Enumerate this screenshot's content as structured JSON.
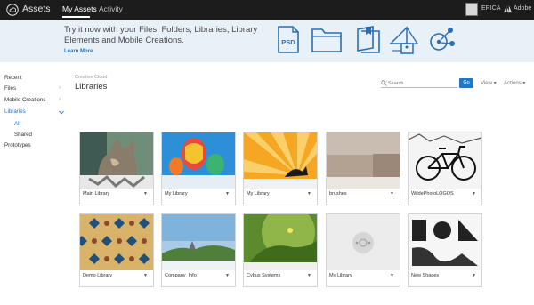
{
  "topbar": {
    "app_name": "Assets",
    "nav": [
      {
        "label": "My Assets"
      },
      {
        "label": "Activity"
      }
    ],
    "user_name": "ERICA",
    "company": "Adobe"
  },
  "banner": {
    "line1": "Try it now with your Files, Folders, Libraries, Library",
    "line2": "Elements and Mobile Creations.",
    "learn_more": "Learn More",
    "psd_label": "PSD",
    "icons": [
      "psd-file-icon",
      "folder-icon",
      "library-book-icon",
      "photoshop-icon",
      "share-network-icon"
    ]
  },
  "sidebar": {
    "items": [
      {
        "label": "Recent"
      },
      {
        "label": "Files"
      },
      {
        "label": "Mobile Creations"
      },
      {
        "label": "Libraries"
      },
      {
        "label": "All"
      },
      {
        "label": "Shared"
      },
      {
        "label": "Prototypes"
      }
    ]
  },
  "header": {
    "breadcrumb": "Creative Cloud",
    "title": "Libraries"
  },
  "toolbar": {
    "search_placeholder": "Search",
    "go_label": "Go",
    "view_label": "View",
    "actions_label": "Actions"
  },
  "libraries": [
    {
      "name": "Main Library"
    },
    {
      "name": "My Library"
    },
    {
      "name": "My Library"
    },
    {
      "name": "brushes"
    },
    {
      "name": "WildePhotoLOGOS"
    },
    {
      "name": "Demo Library"
    },
    {
      "name": "Company_Info"
    },
    {
      "name": "Cybus Systems"
    },
    {
      "name": "My Library"
    },
    {
      "name": "New Shapes"
    }
  ],
  "colors": {
    "topbar": "#1c1c1c",
    "banner": "#e9f1f8",
    "accent": "#1f77c6"
  }
}
